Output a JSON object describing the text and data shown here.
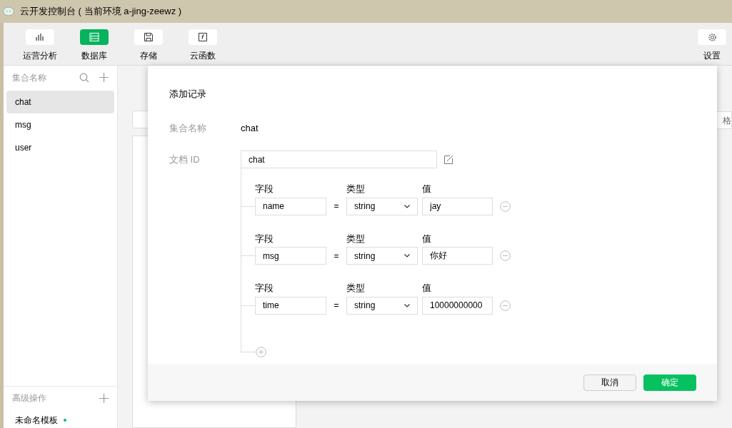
{
  "window": {
    "title": "云开发控制台 ( 当前环境 a-jing-zeewz )"
  },
  "toolbar": [
    {
      "label": "运营分析",
      "kind": "chart",
      "selected": false
    },
    {
      "label": "数据库",
      "kind": "database",
      "selected": true
    },
    {
      "label": "存储",
      "kind": "storage",
      "selected": false
    },
    {
      "label": "云函数",
      "kind": "function",
      "selected": false
    }
  ],
  "settings": {
    "label": "设置"
  },
  "sidebar": {
    "header": "集合名称",
    "items": [
      {
        "label": "chat",
        "selected": true
      },
      {
        "label": "msg",
        "selected": false
      },
      {
        "label": "user",
        "selected": false
      }
    ],
    "advanced": {
      "header": "高级操作",
      "items": [
        {
          "label": "未命名模板",
          "color": "#07c160"
        }
      ]
    }
  },
  "background": {
    "field_text": "格"
  },
  "dialog": {
    "title": "添加记录",
    "collection_label": "集合名称",
    "collection_value": "chat",
    "doc_id_label": "文档 ID",
    "doc_id_value": "chat",
    "fields": [
      {
        "field_header": "字段",
        "type_header": "类型",
        "value_header": "值",
        "equals": "=",
        "name": "name",
        "type": "string",
        "value": "jay"
      },
      {
        "field_header": "字段",
        "type_header": "类型",
        "value_header": "值",
        "equals": "=",
        "name": "msg",
        "type": "string",
        "value": "你好"
      },
      {
        "field_header": "字段",
        "type_header": "类型",
        "value_header": "值",
        "equals": "=",
        "name": "time",
        "type": "string",
        "value": "10000000000"
      }
    ],
    "buttons": {
      "cancel": "取消",
      "confirm": "确定"
    }
  }
}
